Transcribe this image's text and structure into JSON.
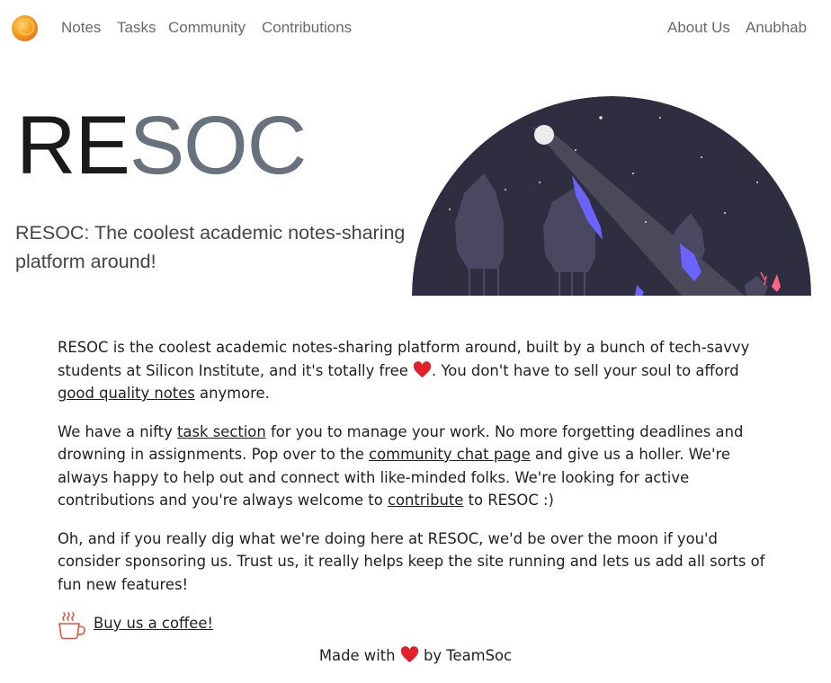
{
  "nav": {
    "logo": "orange-orb-logo",
    "links": [
      "Notes",
      "Tasks",
      "Community",
      "Contributions"
    ],
    "right_links": [
      "About Us",
      "Anubhab"
    ]
  },
  "hero": {
    "title_part1": "RE",
    "title_part2": "SOC",
    "tagline": "RESOC: The coolest academic notes-sharing platform around!",
    "illustration": "night-sky-forest-illustration"
  },
  "content": {
    "p1": {
      "t1": "RESOC is the coolest academic notes-sharing platform around, built by a bunch of tech-savvy students at Silicon Institute, and it's totally free ",
      "t2": ". You don't have to sell your soul to afford ",
      "link": "good quality notes",
      "t3": " anymore."
    },
    "p2": {
      "t1": "We have a nifty ",
      "link1": "task section",
      "t2": " for you to manage your work. No more forgetting deadlines and drowning in assignments. Pop over to the ",
      "link2": "community chat page",
      "t3": " and give us a holler. We're always happy to help out and connect with like-minded folks. We're looking for active contributions and you're always welcome to ",
      "link3": "contribute",
      "t4": " to RESOC :)"
    },
    "p3": "Oh, and if you really dig what we're doing here at RESOC, we'd be over the moon if you'd consider sponsoring us. Trust us, it really helps keep the site running and lets us add all sorts of fun new features!",
    "coffee_label": "Buy us a coffee!"
  },
  "footer": {
    "t1": "Made with ",
    "t2": " by TeamSoc"
  },
  "icons": {
    "heart": "heart-icon",
    "coffee": "coffee-cup-icon"
  },
  "colors": {
    "heart": "#e0202a",
    "title_dark": "#1a1a1a",
    "title_light": "#68727d",
    "nav_text": "#6a6a6a",
    "night_sky": "#2f2e41",
    "accent_purple": "#6c63ff",
    "logo_orange": "#f5a623",
    "coffee_red": "#e8543a"
  }
}
